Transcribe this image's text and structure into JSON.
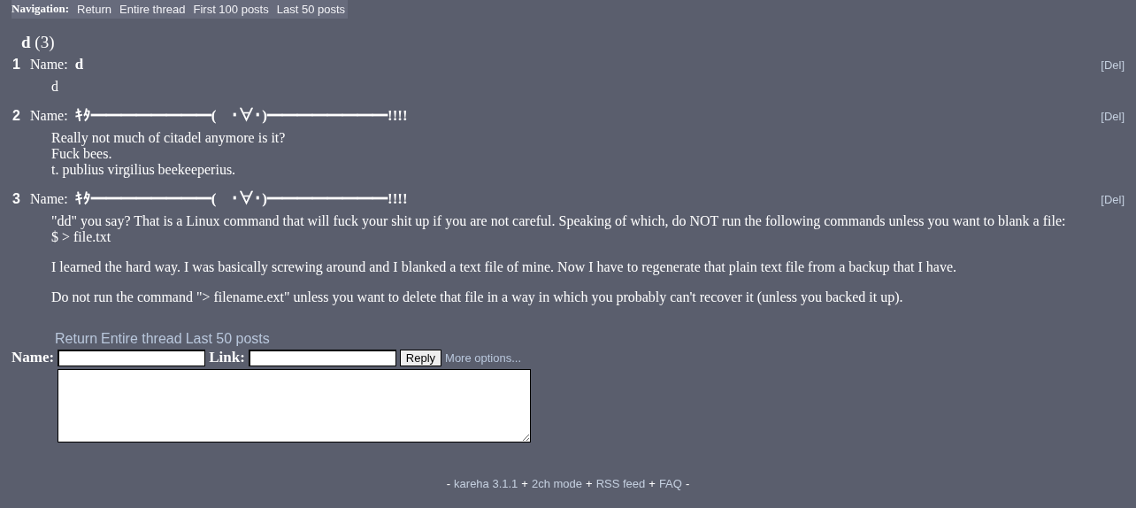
{
  "navigation": {
    "label": "Navigation:",
    "links": [
      "Return",
      "Entire thread",
      "First 100 posts",
      "Last 50 posts"
    ]
  },
  "thread": {
    "title": "d",
    "count": "(3)"
  },
  "posts": [
    {
      "number": "1",
      "name_label": "Name:",
      "name": "d",
      "delete": "[Del]",
      "paragraphs": [
        [
          "d"
        ]
      ]
    },
    {
      "number": "2",
      "name_label": "Name:",
      "name": "ｷﾀ━━━━━━━━(　･∀･)━━━━━━━━!!!!",
      "delete": "[Del]",
      "paragraphs": [
        [
          "Really not much of citadel anymore is it?",
          "Fuck bees.",
          "t. publius virgilius beekeeperius."
        ]
      ]
    },
    {
      "number": "3",
      "name_label": "Name:",
      "name": "ｷﾀ━━━━━━━━(　･∀･)━━━━━━━━!!!!",
      "delete": "[Del]",
      "paragraphs": [
        [
          "\"dd\" you say? That is a Linux command that will fuck your shit up if you are not careful. Speaking of which, do NOT run the following commands unless you want to blank a file:",
          "$ > file.txt"
        ],
        [
          "I learned the hard way. I was basically screwing around and I blanked a text file of mine. Now I have to regenerate that plain text file from a backup that I have."
        ],
        [
          "Do not run the command \"> filename.ext\" unless you want to delete that file in a way in which you probably can't recover it (unless you backed it up)."
        ]
      ]
    }
  ],
  "bottom_links": [
    "Return",
    "Entire thread",
    "Last 50 posts"
  ],
  "reply_form": {
    "name_label": "Name:",
    "link_label": "Link:",
    "submit": "Reply",
    "more": "More options..."
  },
  "footer": {
    "items": [
      {
        "kind": "sep",
        "text": "-"
      },
      {
        "kind": "link",
        "text": "kareha 3.1.1"
      },
      {
        "kind": "sep",
        "text": "+"
      },
      {
        "kind": "link",
        "text": "2ch mode"
      },
      {
        "kind": "sep",
        "text": "+"
      },
      {
        "kind": "link",
        "text": "RSS feed"
      },
      {
        "kind": "sep",
        "text": "+"
      },
      {
        "kind": "link",
        "text": "FAQ"
      },
      {
        "kind": "sep",
        "text": "-"
      }
    ]
  }
}
